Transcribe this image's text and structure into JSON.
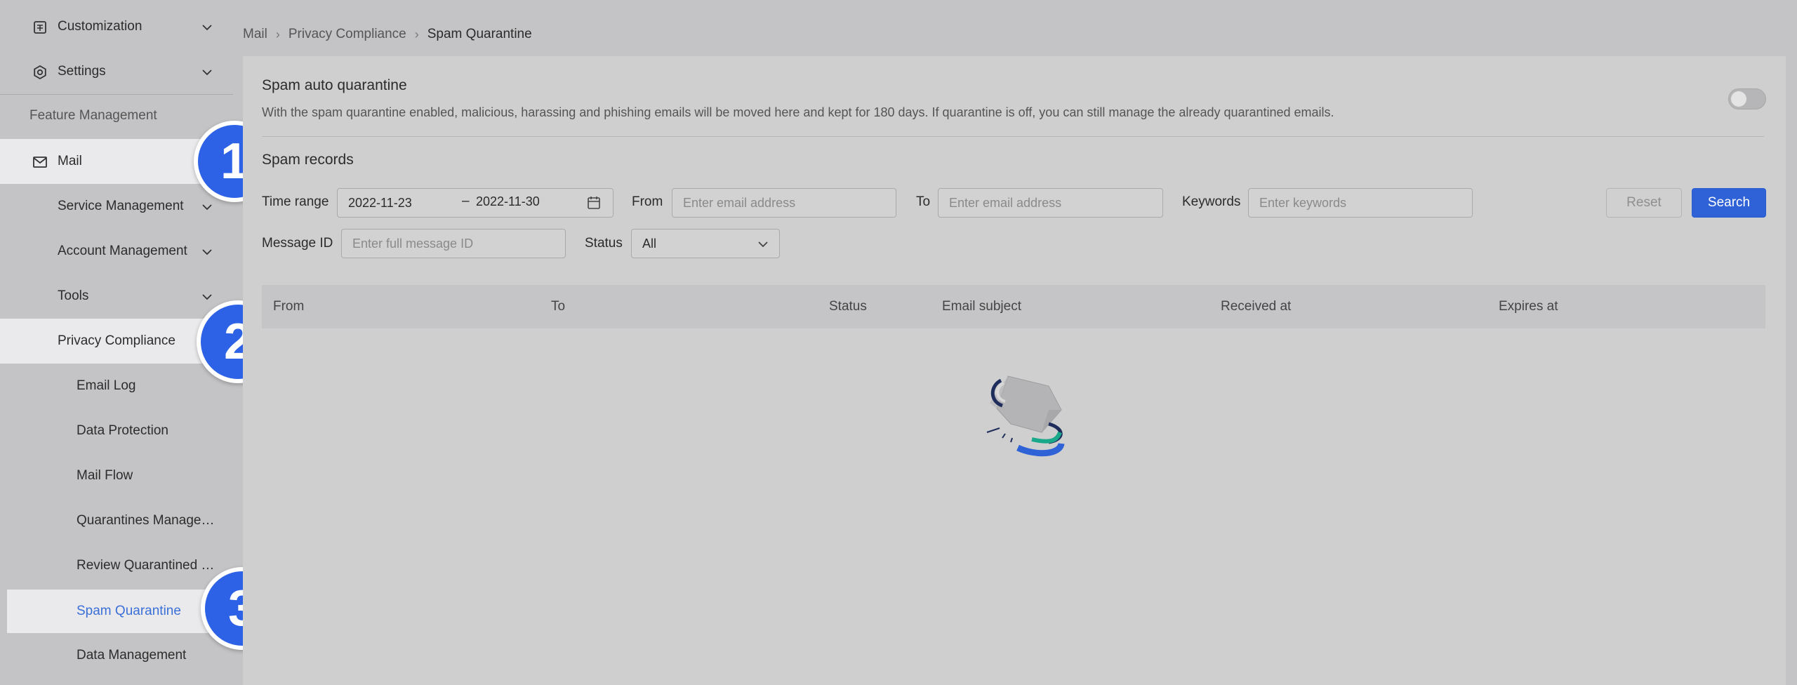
{
  "sidebar": {
    "customization": "Customization",
    "settings": "Settings",
    "feature_management": "Feature Management",
    "mail": "Mail",
    "service_management": "Service Management",
    "account_management": "Account Management",
    "tools": "Tools",
    "privacy_compliance": "Privacy Compliance",
    "email_log": "Email Log",
    "data_protection": "Data Protection",
    "mail_flow": "Mail Flow",
    "quarantines_management": "Quarantines Manage…",
    "review_quarantined": "Review Quarantined …",
    "spam_quarantine": "Spam Quarantine",
    "data_management": "Data Management"
  },
  "callouts": [
    "1",
    "2",
    "3"
  ],
  "breadcrumb": {
    "items": [
      "Mail",
      "Privacy Compliance",
      "Spam Quarantine"
    ]
  },
  "auto_quarantine": {
    "title": "Spam auto quarantine",
    "description": "With the spam quarantine enabled, malicious, harassing and phishing emails will be moved here and kept for 180 days. If quarantine is off, you can still manage the already quarantined emails.",
    "enabled": false
  },
  "records": {
    "title": "Spam records",
    "filters": {
      "time_range_label": "Time range",
      "date_start": "2022-11-23",
      "date_end": "2022-11-30",
      "from_label": "From",
      "from_placeholder": "Enter email address",
      "to_label": "To",
      "to_placeholder": "Enter email address",
      "keywords_label": "Keywords",
      "keywords_placeholder": "Enter keywords",
      "message_id_label": "Message ID",
      "message_id_placeholder": "Enter full message ID",
      "status_label": "Status",
      "status_value": "All",
      "reset": "Reset",
      "search": "Search"
    },
    "columns": [
      "From",
      "To",
      "Status",
      "Email subject",
      "Received at",
      "Expires at"
    ]
  },
  "colors": {
    "accent": "#2f62d6",
    "active_link": "#3a6fd8",
    "callout": "#2e62e6"
  }
}
